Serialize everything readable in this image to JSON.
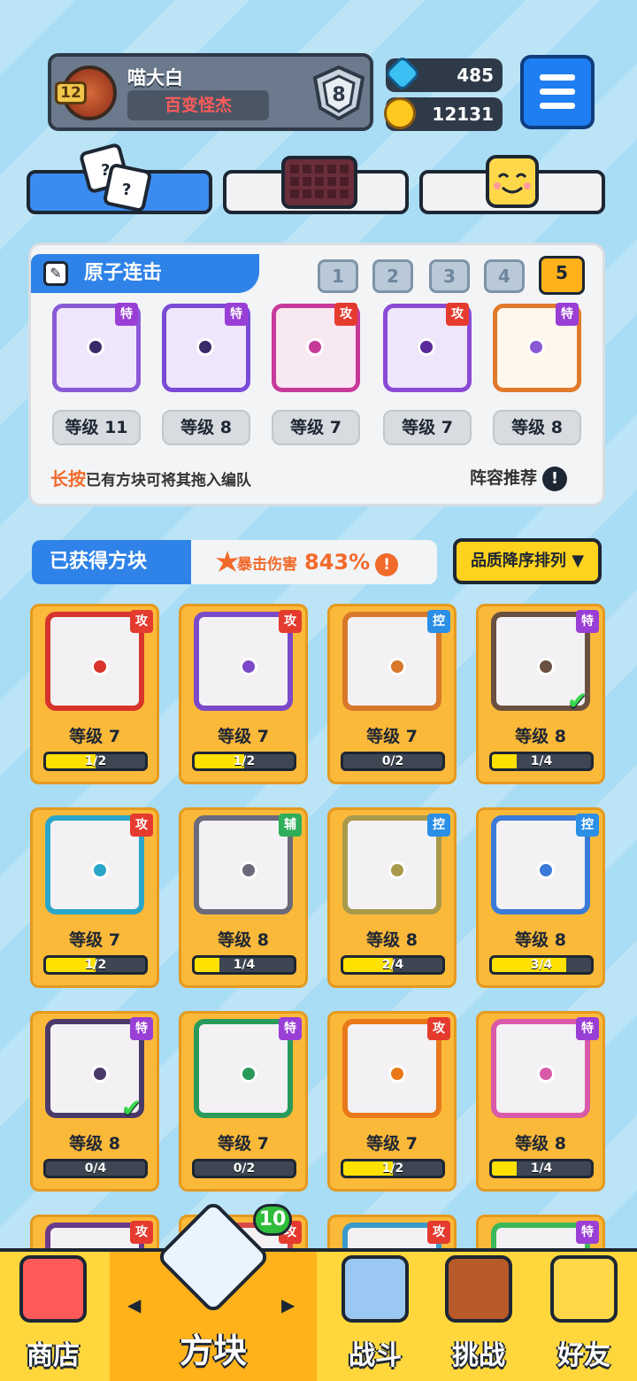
{
  "profile": {
    "name": "喵大白",
    "title": "百变怪杰",
    "level": "12",
    "rank": "8"
  },
  "resources": {
    "gems": "485",
    "coins": "12131"
  },
  "combo": {
    "title": "原子连击",
    "slots": [
      "1",
      "2",
      "3",
      "4",
      "5"
    ],
    "active_slot": "5",
    "cards": [
      {
        "tag": "特",
        "level": "等级 11",
        "color": "#8a5ad6"
      },
      {
        "tag": "特",
        "level": "等级 8",
        "color": "#7a4ad6"
      },
      {
        "tag": "攻",
        "level": "等级 7",
        "color": "#c83a9a"
      },
      {
        "tag": "攻",
        "level": "等级 7",
        "color": "#8a4ad6"
      },
      {
        "tag": "特",
        "level": "等级 8",
        "color": "#e07a2a"
      }
    ],
    "hint_highlight": "长按",
    "hint_text": "已有方块可将其拖入编队",
    "recommend": "阵容推荐",
    "recommend_icon": "!"
  },
  "owned": {
    "title": "已获得方块",
    "crit_label": "暴击伤害",
    "crit_value": "843%",
    "crit_icon": "!",
    "sort_label": "品质降序排列 ▼",
    "cards": [
      {
        "tag": "攻",
        "tag_type": "atk",
        "level": "等级 7",
        "progress": "1/2",
        "fill": 0.5,
        "color": "#d8342c",
        "checked": false
      },
      {
        "tag": "攻",
        "tag_type": "atk",
        "level": "等级 7",
        "progress": "1/2",
        "fill": 0.5,
        "color": "#7c4ac8",
        "checked": false
      },
      {
        "tag": "控",
        "tag_type": "ctl",
        "level": "等级 7",
        "progress": "0/2",
        "fill": 0,
        "color": "#d8782a",
        "checked": false
      },
      {
        "tag": "特",
        "tag_type": "spc",
        "level": "等级 8",
        "progress": "1/4",
        "fill": 0.25,
        "color": "#6a5040",
        "checked": true
      },
      {
        "tag": "攻",
        "tag_type": "atk",
        "level": "等级 7",
        "progress": "1/2",
        "fill": 0.5,
        "color": "#2aa6c8",
        "checked": false
      },
      {
        "tag": "辅",
        "tag_type": "sup",
        "level": "等级 8",
        "progress": "1/4",
        "fill": 0.25,
        "color": "#6a6a7a",
        "checked": false
      },
      {
        "tag": "控",
        "tag_type": "ctl",
        "level": "等级 8",
        "progress": "2/4",
        "fill": 0.5,
        "color": "#a89a4a",
        "checked": false
      },
      {
        "tag": "控",
        "tag_type": "ctl",
        "level": "等级 8",
        "progress": "3/4",
        "fill": 0.75,
        "color": "#3a7ad8",
        "checked": false
      },
      {
        "tag": "特",
        "tag_type": "spc",
        "level": "等级 8",
        "progress": "0/4",
        "fill": 0,
        "color": "#4a3a6a",
        "checked": true
      },
      {
        "tag": "特",
        "tag_type": "spc",
        "level": "等级 7",
        "progress": "0/2",
        "fill": 0,
        "color": "#2a9a5a",
        "checked": false
      },
      {
        "tag": "攻",
        "tag_type": "atk",
        "level": "等级 7",
        "progress": "1/2",
        "fill": 0.5,
        "color": "#e8781a",
        "checked": false
      },
      {
        "tag": "特",
        "tag_type": "spc",
        "level": "等级 8",
        "progress": "1/4",
        "fill": 0.25,
        "color": "#d85aa8",
        "checked": false
      },
      {
        "tag": "攻",
        "tag_type": "atk",
        "color": "#6a3a8a"
      },
      {
        "tag": "攻",
        "tag_type": "atk",
        "color": "#d84a4a"
      },
      {
        "tag": "攻",
        "tag_type": "atk",
        "color": "#3a9ac8"
      },
      {
        "tag": "特",
        "tag_type": "spc",
        "color": "#3ab85a"
      }
    ]
  },
  "nav": {
    "shop": "商店",
    "blocks": "方块",
    "battle": "战斗",
    "challenge": "挑战",
    "friends": "好友",
    "blocks_badge": "10",
    "arrow_left": "◀",
    "arrow_right": "▶"
  }
}
